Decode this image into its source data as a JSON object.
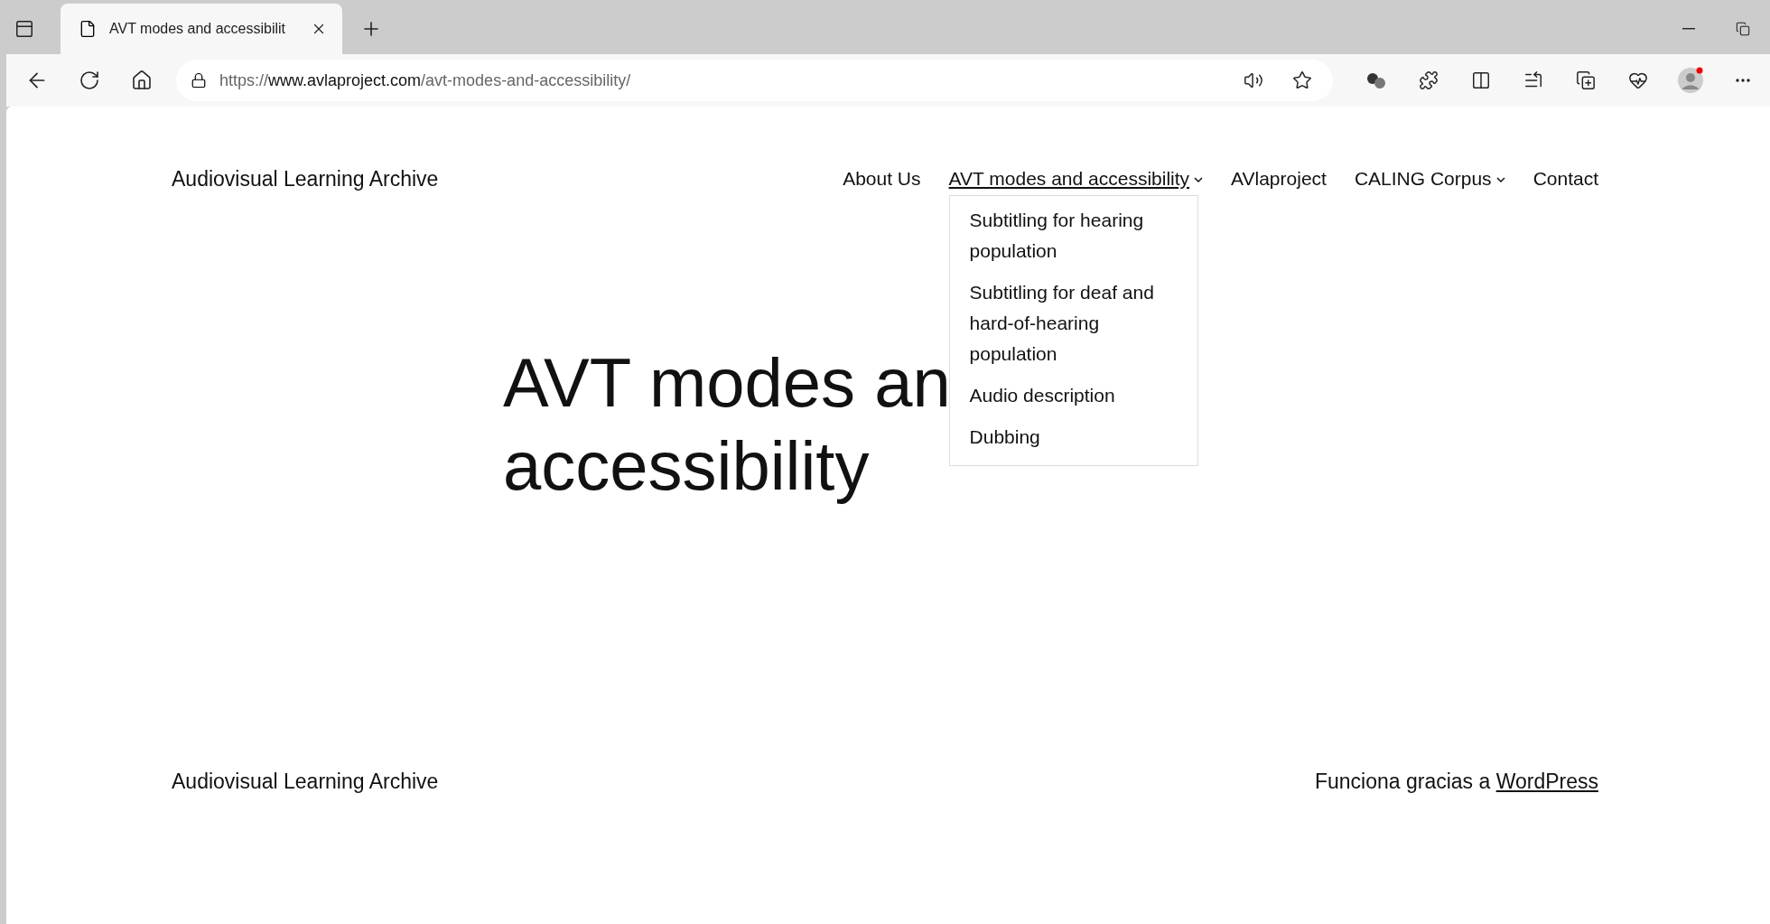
{
  "browser": {
    "tab": {
      "title": "AVT modes and accessibilit"
    },
    "address": {
      "scheme": "https://",
      "host": "www.avlaproject.com",
      "path": "/avt-modes-and-accessibility/"
    }
  },
  "site": {
    "title": "Audiovisual Learning Archive"
  },
  "nav": [
    {
      "label": "About Us",
      "selected": false,
      "has_submenu": false
    },
    {
      "label": "AVT modes and accessibility",
      "selected": true,
      "has_submenu": true,
      "children": [
        "Subtitling for hearing population",
        "Subtitling for deaf and hard-of-hearing population",
        "Audio description",
        "Dubbing"
      ]
    },
    {
      "label": "AVlaproject",
      "selected": false,
      "has_submenu": false
    },
    {
      "label": "CALING Corpus",
      "selected": false,
      "has_submenu": true
    },
    {
      "label": "Contact",
      "selected": false,
      "has_submenu": false
    }
  ],
  "heading": [
    "AVT modes an",
    "accessibility"
  ],
  "footer": {
    "site_title": "Audiovisual Learning Archive",
    "credit": "Funciona gracias a",
    "credit_link": "WordPress"
  }
}
